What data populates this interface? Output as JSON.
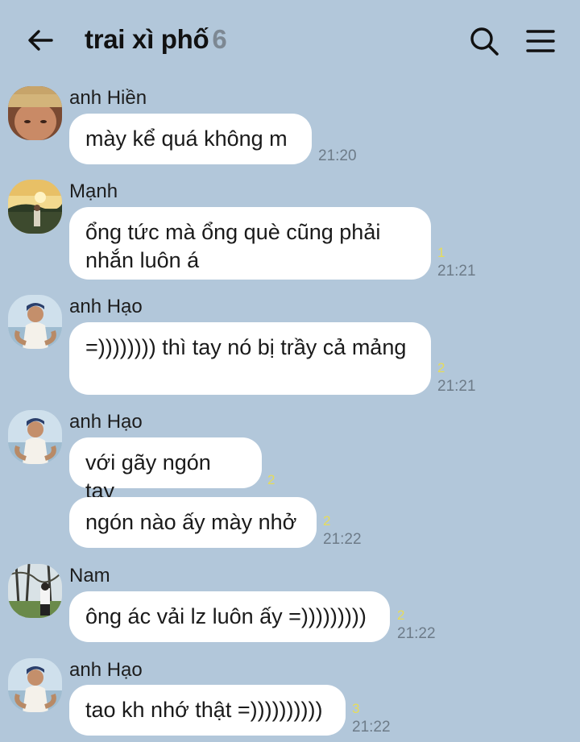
{
  "header": {
    "title": "trai xì phố",
    "member_count": "6",
    "back_icon": "arrow-left-icon",
    "search_icon": "search-icon",
    "menu_icon": "menu-icon"
  },
  "messages": [
    {
      "sender": "anh Hiền",
      "text": "mày kể quá không m",
      "unread": "",
      "time": "21:20"
    },
    {
      "sender": "Mạnh",
      "text": "ổng tức mà ổng què cũng phải nhắn luôn á",
      "unread": "1",
      "time": "21:21"
    },
    {
      "sender": "anh Hạo",
      "text": "=)))))))) thì tay nó bị trầy cả mảng",
      "unread": "2",
      "time": "21:21"
    },
    {
      "sender": "anh Hạo",
      "text": "với gãy ngón tay",
      "unread": "2",
      "time": ""
    },
    {
      "sender": "",
      "text": "ngón nào ấy mày nhở",
      "unread": "2",
      "time": "21:22"
    },
    {
      "sender": "Nam",
      "text": "ông ác vải lz luôn ấy =)))))))))",
      "unread": "2",
      "time": "21:22"
    },
    {
      "sender": "anh Hạo",
      "text": "tao kh nhớ thật =))))))))))",
      "unread": "3",
      "time": "21:22"
    }
  ],
  "colors": {
    "background": "#b2c7da",
    "bubble": "#ffffff",
    "unread": "#e6dc5a",
    "time": "#6d7b88"
  }
}
